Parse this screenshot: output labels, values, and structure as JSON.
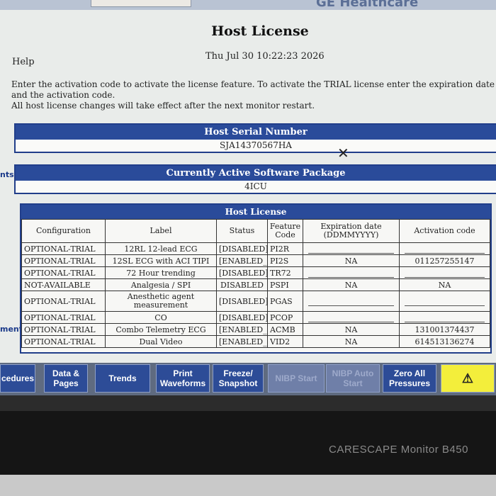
{
  "brand_text": "GE Healthcare",
  "page": {
    "title": "Host License",
    "datetime": "Thu Jul 30 10:22:23 2026",
    "help_label": "Help",
    "instructions": [
      "Enter the activation code to activate the license feature. To activate the TRIAL license enter the expiration date and the activation code.",
      "All host license changes will take effect after the next monitor restart."
    ]
  },
  "serial": {
    "header": "Host Serial Number",
    "value": "SJA14370567HA"
  },
  "software": {
    "header": "Currently Active Software Package",
    "value": "4ICU",
    "side_label": "nts"
  },
  "license_table": {
    "header": "Host License",
    "side_label": "ment",
    "columns": [
      "Configuration",
      "Label",
      "Status",
      "Feature Code",
      "Expiration date (DDMMYYYY)",
      "Activation code"
    ],
    "rows": [
      {
        "config": "OPTIONAL-TRIAL",
        "label": "12RL 12-lead ECG",
        "status": "[DISABLED]",
        "code": "PI2R",
        "expiration": "",
        "activation": ""
      },
      {
        "config": "OPTIONAL-TRIAL",
        "label": "12SL ECG with ACI TIPI",
        "status": "[ENABLED_]",
        "code": "PI2S",
        "expiration": "NA",
        "activation": "011257255147"
      },
      {
        "config": "OPTIONAL-TRIAL",
        "label": "72 Hour trending",
        "status": "[DISABLED]",
        "code": "TR72",
        "expiration": "",
        "activation": ""
      },
      {
        "config": "NOT-AVAILABLE",
        "label": "Analgesia / SPI",
        "status": "DISABLED",
        "code": "PSPI",
        "expiration": "NA",
        "activation": "NA"
      },
      {
        "config": "OPTIONAL-TRIAL",
        "label": "Anesthetic agent measurement",
        "status": "[DISABLED]",
        "code": "PGAS",
        "expiration": "",
        "activation": ""
      },
      {
        "config": "OPTIONAL-TRIAL",
        "label": "CO",
        "status": "[DISABLED]",
        "code": "PCOP",
        "expiration": "",
        "activation": ""
      },
      {
        "config": "OPTIONAL-TRIAL",
        "label": "Combo Telemetry ECG",
        "status": "[ENABLED_]",
        "code": "ACMB",
        "expiration": "NA",
        "activation": "131001374437"
      },
      {
        "config": "OPTIONAL-TRIAL",
        "label": "Dual Video",
        "status": "[ENABLED_]",
        "code": "VID2",
        "expiration": "NA",
        "activation": "614513136274"
      }
    ]
  },
  "bottom_bar": {
    "procedures": "cedures",
    "data_pages": "Data & Pages",
    "trends": "Trends",
    "print_waveforms": "Print Waveforms",
    "freeze_snapshot": "Freeze/ Snapshot",
    "nibp_start": "NIBP Start",
    "nibp_auto_start": "NIBP Auto Start",
    "zero_all": "Zero All Pressures",
    "alarm_icon": "⚠"
  },
  "device_model": "CARESCAPE Monitor B450"
}
